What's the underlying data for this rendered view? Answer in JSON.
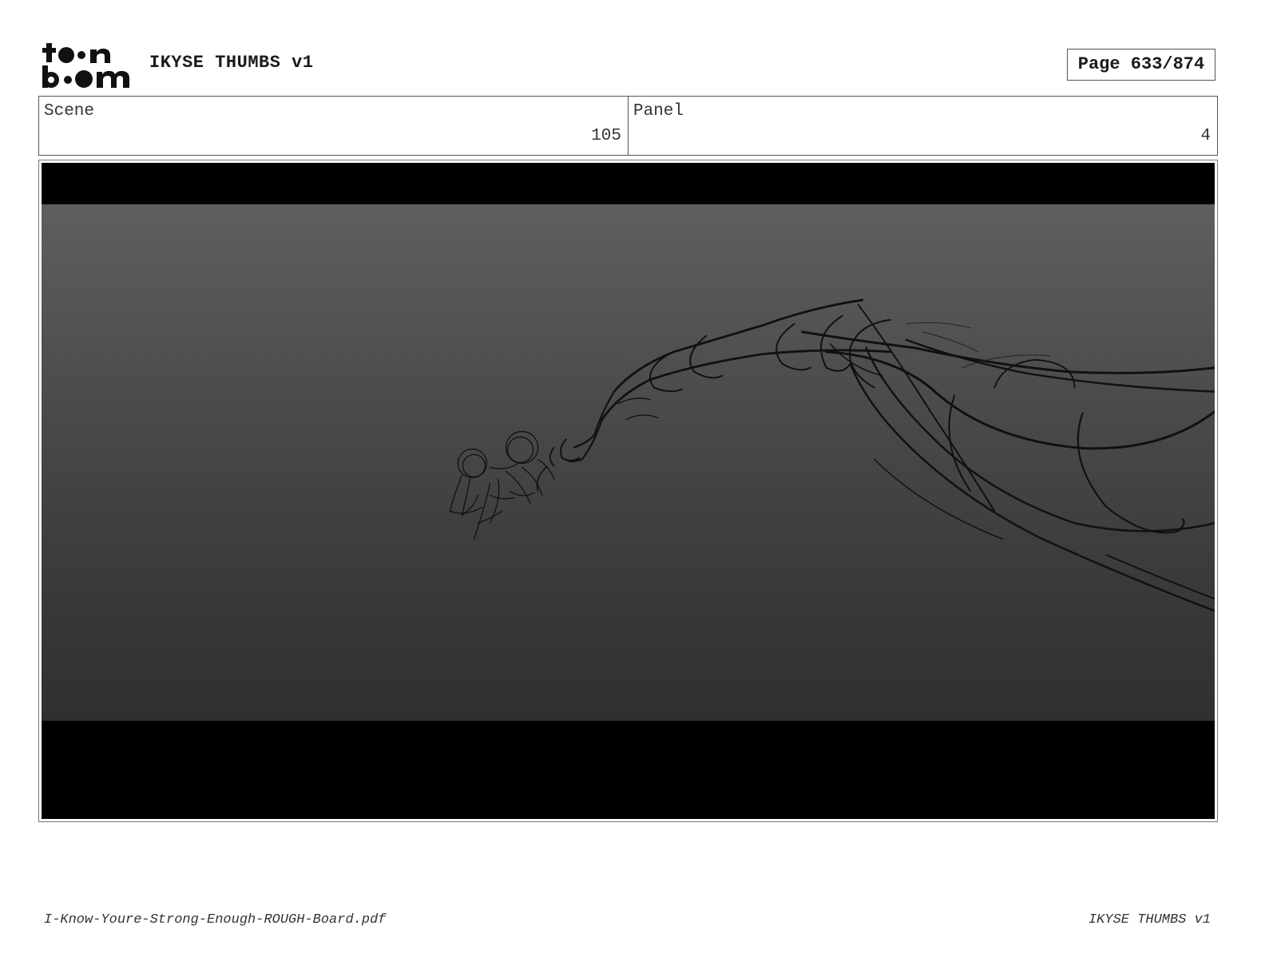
{
  "header": {
    "logo_text": "toon boom",
    "document_title": "IKYSE THUMBS v1",
    "page_label": "Page 633/874"
  },
  "info": {
    "scene_label": "Scene",
    "scene_value": "105",
    "panel_label": "Panel",
    "panel_value": "4"
  },
  "footer": {
    "filename": "I-Know-Youre-Strong-Enough-ROUGH-Board.pdf",
    "project": "IKYSE THUMBS v1"
  },
  "colors": {
    "frame_background": "#000000",
    "sketch_stroke": "#111111"
  }
}
